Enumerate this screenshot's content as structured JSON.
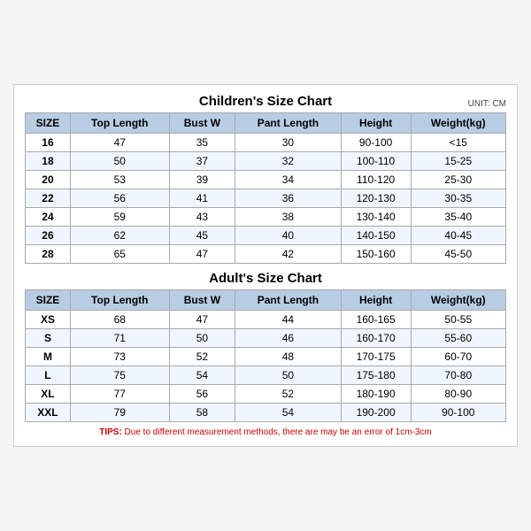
{
  "children_title": "Children's Size Chart",
  "adult_title": "Adult's Size Chart",
  "unit": "UNIT: CM",
  "tips": "TIPS: Due to different measurement methods, there are may be an error of 1cm-3cm",
  "tips_label": "TIPS:",
  "tips_body": " Due to different measurement methods, there are may be an error of 1cm-3cm",
  "columns": [
    "SIZE",
    "Top Length",
    "Bust W",
    "Pant Length",
    "Height",
    "Weight(kg)"
  ],
  "children_rows": [
    [
      "16",
      "47",
      "35",
      "30",
      "90-100",
      "<15"
    ],
    [
      "18",
      "50",
      "37",
      "32",
      "100-110",
      "15-25"
    ],
    [
      "20",
      "53",
      "39",
      "34",
      "110-120",
      "25-30"
    ],
    [
      "22",
      "56",
      "41",
      "36",
      "120-130",
      "30-35"
    ],
    [
      "24",
      "59",
      "43",
      "38",
      "130-140",
      "35-40"
    ],
    [
      "26",
      "62",
      "45",
      "40",
      "140-150",
      "40-45"
    ],
    [
      "28",
      "65",
      "47",
      "42",
      "150-160",
      "45-50"
    ]
  ],
  "adult_rows": [
    [
      "XS",
      "68",
      "47",
      "44",
      "160-165",
      "50-55"
    ],
    [
      "S",
      "71",
      "50",
      "46",
      "160-170",
      "55-60"
    ],
    [
      "M",
      "73",
      "52",
      "48",
      "170-175",
      "60-70"
    ],
    [
      "L",
      "75",
      "54",
      "50",
      "175-180",
      "70-80"
    ],
    [
      "XL",
      "77",
      "56",
      "52",
      "180-190",
      "80-90"
    ],
    [
      "XXL",
      "79",
      "58",
      "54",
      "190-200",
      "90-100"
    ]
  ]
}
